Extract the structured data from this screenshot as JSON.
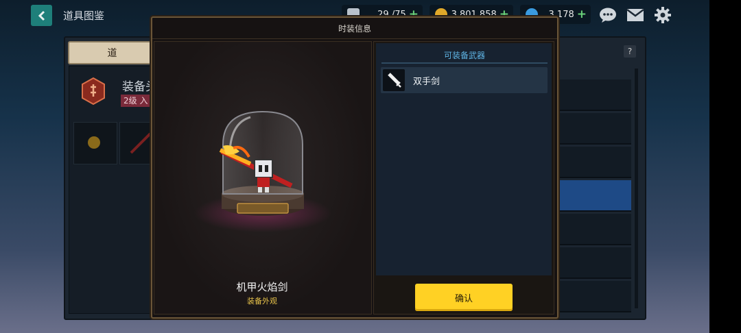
{
  "top_bar": {
    "back_icon": "chevron-left-icon",
    "title": "道具图鉴",
    "currencies": [
      {
        "icon": "material-icon",
        "value": "29 /75",
        "color": "#b9c2cc"
      },
      {
        "icon": "gold-coin-icon",
        "value": "3,801,858",
        "color": "#e0a92a"
      },
      {
        "icon": "gem-icon",
        "value": "3,178",
        "color": "#3a9be0"
      }
    ],
    "icons": [
      "chat-icon",
      "mail-icon",
      "gear-icon"
    ]
  },
  "background": {
    "tab_label": "道",
    "section_title": "装备头",
    "level_badge": "2级 入",
    "help_label": "?"
  },
  "modal": {
    "title": "时装信息",
    "item_name": "机甲火焰剑",
    "item_subtitle": "装备外观",
    "weapons_title": "可装备武器",
    "weapons": [
      {
        "icon": "sword-icon",
        "label": "双手剑"
      }
    ],
    "confirm_label": "确认"
  },
  "colors": {
    "accent_yellow": "#ffd124",
    "weapon_title_blue": "#5fb4e4",
    "subtitle_gold": "#e6c24a",
    "selected_row_blue": "#1e4a86"
  }
}
